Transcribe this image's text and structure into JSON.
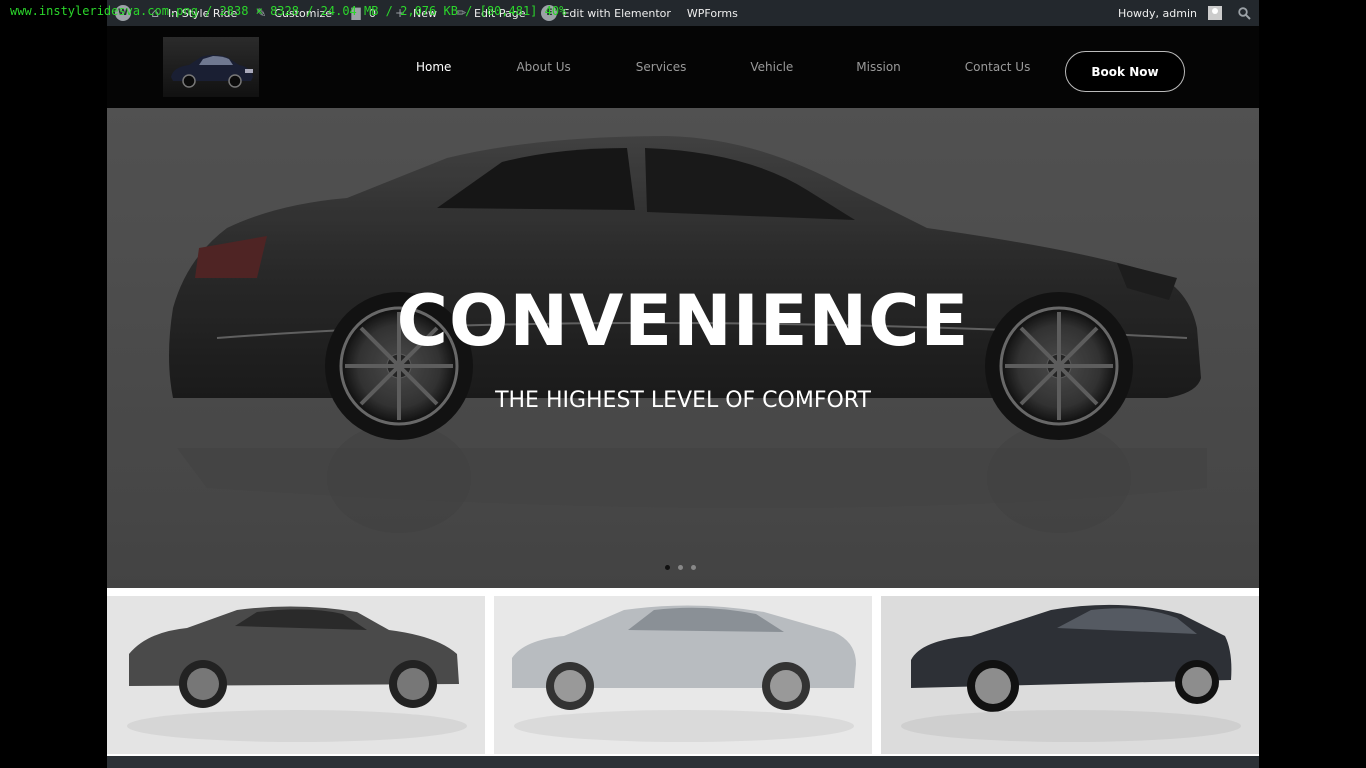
{
  "overlay": {
    "text": "www.instyleridesva.com.png / 2838 × 8328 / 24.04 MB / 2,076 KB / [80,481] 40%"
  },
  "adminbar": {
    "site_name": "In Style Ride",
    "customize": "Customize",
    "comments_count": "0",
    "new": "New",
    "edit_page": "Edit Page",
    "elementor": "Edit with Elementor",
    "wpforms": "WPForms",
    "howdy": "Howdy, admin"
  },
  "nav": {
    "items": [
      "Home",
      "About Us",
      "Services",
      "Vehicle",
      "Mission",
      "Contact Us"
    ],
    "active": "Home",
    "book_label": "Book Now"
  },
  "hero": {
    "title": "CONVENIENCE",
    "subtitle": "THE HIGHEST LEVEL OF COMFORT",
    "slides": 3,
    "active_slide": 1
  },
  "colors": {
    "adminbar_bg": "#23282d",
    "header_bg": "#050505",
    "hero_bg": "#5a5a5a",
    "text_white": "#ffffff",
    "nav_inactive": "#9a9a9a"
  },
  "icons": {
    "wp": "wordpress-icon",
    "home": "home-icon",
    "customize": "brush-icon",
    "comments": "comment-icon",
    "new": "plus-icon",
    "edit": "pencil-icon",
    "elementor": "elementor-icon",
    "search": "search-icon"
  }
}
